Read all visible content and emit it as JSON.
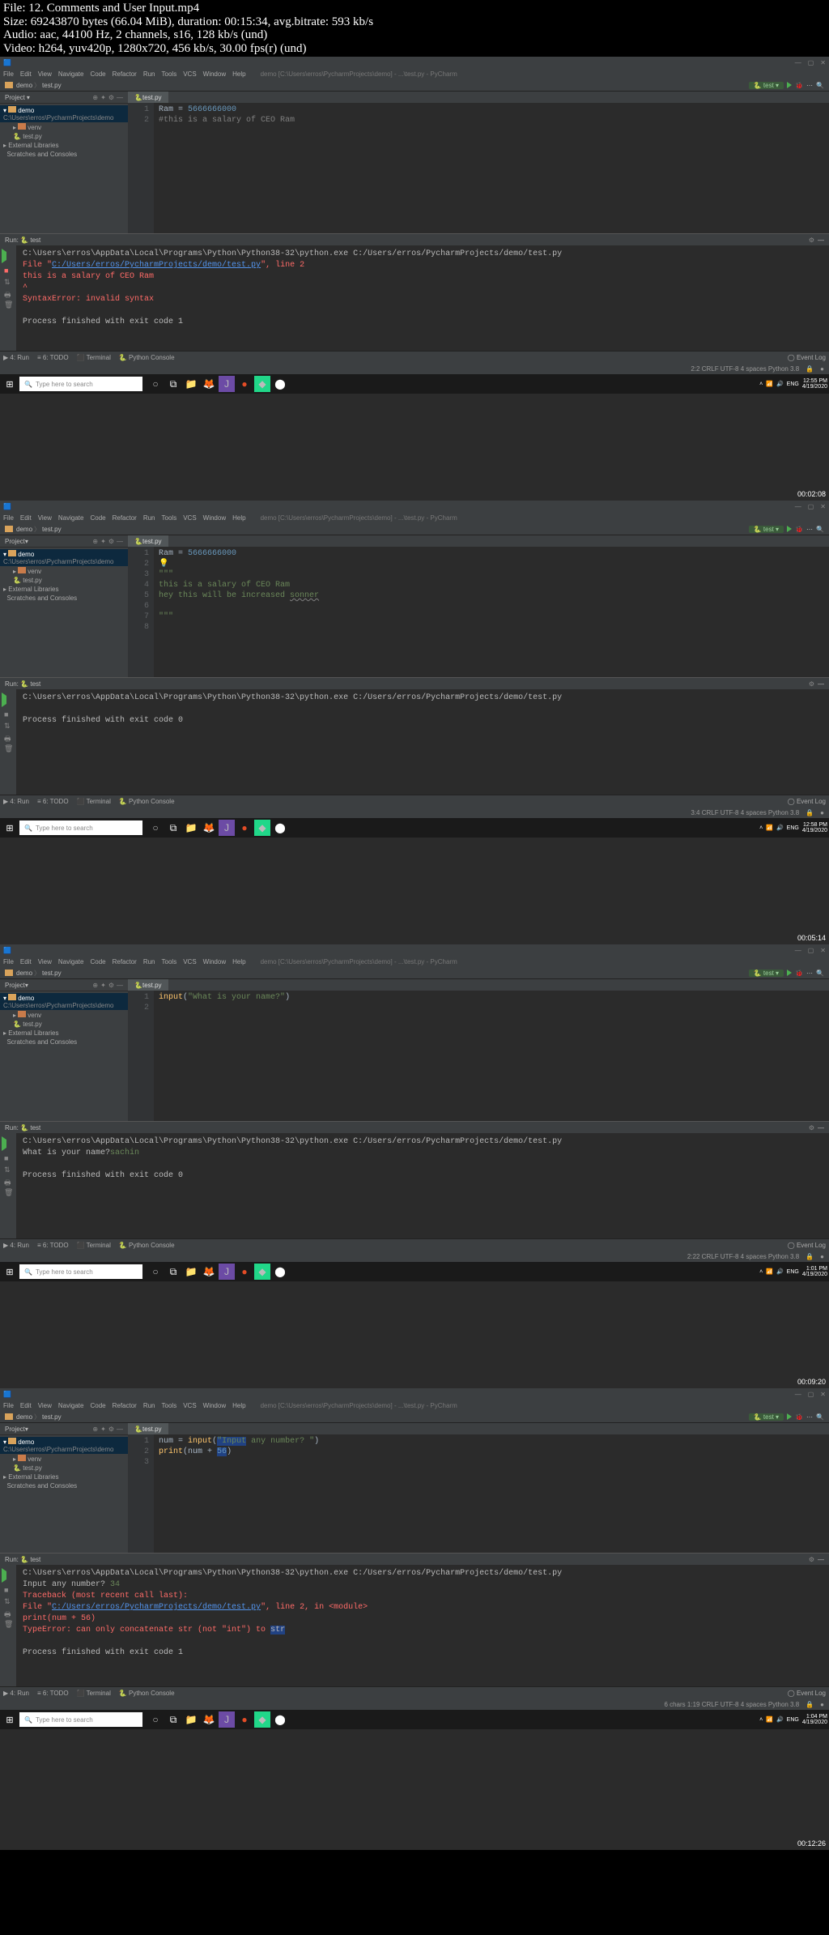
{
  "header": {
    "line1": "File: 12. Comments and User Input.mp4",
    "line2": "Size: 69243870 bytes (66.04 MiB), duration: 00:15:34, avg.bitrate: 593 kb/s",
    "line3": "Audio: aac, 44100 Hz, 2 channels, s16, 128 kb/s (und)",
    "line4": "Video: h264, yuv420p, 1280x720, 456 kb/s, 30.00 fps(r) (und)"
  },
  "menu": {
    "file": "File",
    "edit": "Edit",
    "view": "View",
    "navigate": "Navigate",
    "code": "Code",
    "refactor": "Refactor",
    "run": "Run",
    "tools": "Tools",
    "vcs": "VCS",
    "window": "Window",
    "help": "Help"
  },
  "breadcrumb": "demo [C:\\Users\\erros\\PycharmProjects\\demo] - ...\\test.py - PyCharm",
  "nav": {
    "demo": "demo",
    "testpy": "test.py",
    "test_btn": "test"
  },
  "project": {
    "label": "Project",
    "root": "demo",
    "root_path": "C:\\Users\\erros\\PycharmProjects\\demo",
    "venv": "venv",
    "testpy": "test.py",
    "extlib": "External Libraries",
    "scratches": "Scratches and Consoles"
  },
  "editor_tab": "test.py",
  "shot1": {
    "lines": [
      "1",
      "2"
    ],
    "code_l1_var": "Ram",
    "code_l1_eq": " = ",
    "code_l1_num": "5666666000",
    "code_l2": "#this is a salary of CEO Ram",
    "run_cmd": "C:\\Users\\erros\\AppData\\Local\\Programs\\Python\\Python38-32\\python.exe C:/Users/erros/PycharmProjects/demo/test.py",
    "err1": "  File \"",
    "err1_link": "C:/Users/erros/PycharmProjects/demo/test.py",
    "err1_tail": "\", line 2",
    "err2": "    this is a salary of CEO Ram",
    "err3": "         ^",
    "err4": "SyntaxError: invalid syntax",
    "exit": "Process finished with exit code 1",
    "status": "2:2   CRLF   UTF-8   4 spaces   Python 3.8",
    "clock_time": "12:55 PM",
    "clock_date": "4/19/2020",
    "ts": "00:02:08"
  },
  "shot2": {
    "lines": [
      "1",
      "2",
      "3",
      "4",
      "5",
      "6",
      "7",
      "8"
    ],
    "l1_var": "Ram",
    "l1_eq": " = ",
    "l1_num": "5666666000",
    "l3": "\"\"\"",
    "l4": "this is a salary of CEO Ram",
    "l5a": "hey this will be increased ",
    "l5b": "sonner",
    "l7": "\"\"\"",
    "run_cmd": "C:\\Users\\erros\\AppData\\Local\\Programs\\Python\\Python38-32\\python.exe C:/Users/erros/PycharmProjects/demo/test.py",
    "exit": "Process finished with exit code 0",
    "status": "3:4   CRLF   UTF-8   4 spaces   Python 3.8",
    "clock_time": "12:58 PM",
    "clock_date": "4/19/2020",
    "ts": "00:05:14"
  },
  "shot3": {
    "lines": [
      "1",
      "2"
    ],
    "l1_fn": "input",
    "l1_paren": "(",
    "l1_str": "\"What is your name?\"",
    "l1_close": ")",
    "run_cmd": "C:\\Users\\erros\\AppData\\Local\\Programs\\Python\\Python38-32\\python.exe C:/Users/erros/PycharmProjects/demo/test.py",
    "prompt": "What is your name?",
    "answer": "sachin",
    "exit": "Process finished with exit code 0",
    "status": "2:22   CRLF   UTF-8   4 spaces   Python 3.8",
    "clock_time": "1:01 PM",
    "clock_date": "4/19/2020",
    "ts": "00:09:20"
  },
  "shot4": {
    "lines": [
      "1",
      "2",
      "3"
    ],
    "l1_var": "num",
    "l1_eq": " = ",
    "l1_fn": "input",
    "l1_p": "(",
    "l1_s1": "\"Input",
    "l1_s2": " any number? \"",
    "l1_cp": ")",
    "l2_fn": "print",
    "l2_p": "(",
    "l2_v": "num + ",
    "l2_hi": "56",
    "l2_cp": ")",
    "run_cmd": "C:\\Users\\erros\\AppData\\Local\\Programs\\Python\\Python38-32\\python.exe C:/Users/erros/PycharmProjects/demo/test.py",
    "prompt": "Input any number? ",
    "answer": "34",
    "tb1": "Traceback (most recent call last):",
    "tb2a": "  File \"",
    "tb2_link": "C:/Users/erros/PycharmProjects/demo/test.py",
    "tb2b": "\", line 2, in <module>",
    "tb3": "    print(num + 56)",
    "tb4a": "TypeError: can only concatenate str (not \"int\") to ",
    "tb4b": "str",
    "exit": "Process finished with exit code 1",
    "status": "6 chars   1:19   CRLF   UTF-8   4 spaces   Python 3.8",
    "clock_time": "1:04 PM",
    "clock_date": "4/19/2020",
    "ts": "00:12:26"
  },
  "run_label": "Run:",
  "test_label": "test",
  "bottom": {
    "run": "4: Run",
    "todo": "6: TODO",
    "terminal": "Terminal",
    "console": "Python Console",
    "event_log": "Event Log"
  },
  "search_placeholder": "Type here to search"
}
